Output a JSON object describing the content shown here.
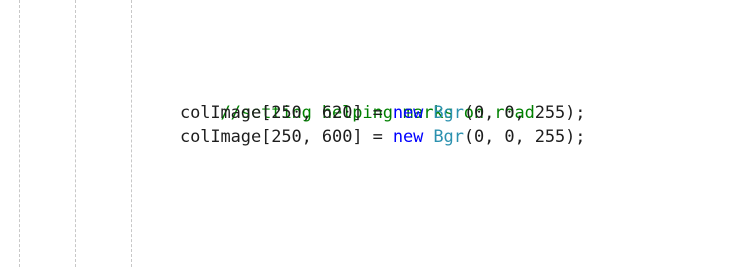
{
  "code": {
    "comment": "//setting helping marks on road",
    "lines": [
      {
        "target": "colImage",
        "open_bracket": "[",
        "index1": "250",
        "sep1": ", ",
        "index2": "620",
        "close_assign": "] = ",
        "keyword": "new",
        "space": " ",
        "type": "Bgr",
        "args": "(0, 0, 255);"
      },
      {
        "target": "colImage",
        "open_bracket": "[",
        "index1": "250",
        "sep1": ", ",
        "index2": "600",
        "close_assign": "] = ",
        "keyword": "new",
        "space": " ",
        "type": "Bgr",
        "args": "(0, 0, 255);"
      }
    ]
  },
  "colors": {
    "comment": "#008000",
    "keyword": "#0000ff",
    "type": "#2b91af",
    "plain": "#1e1e1e",
    "indent_guide": "#c8c8c8"
  }
}
